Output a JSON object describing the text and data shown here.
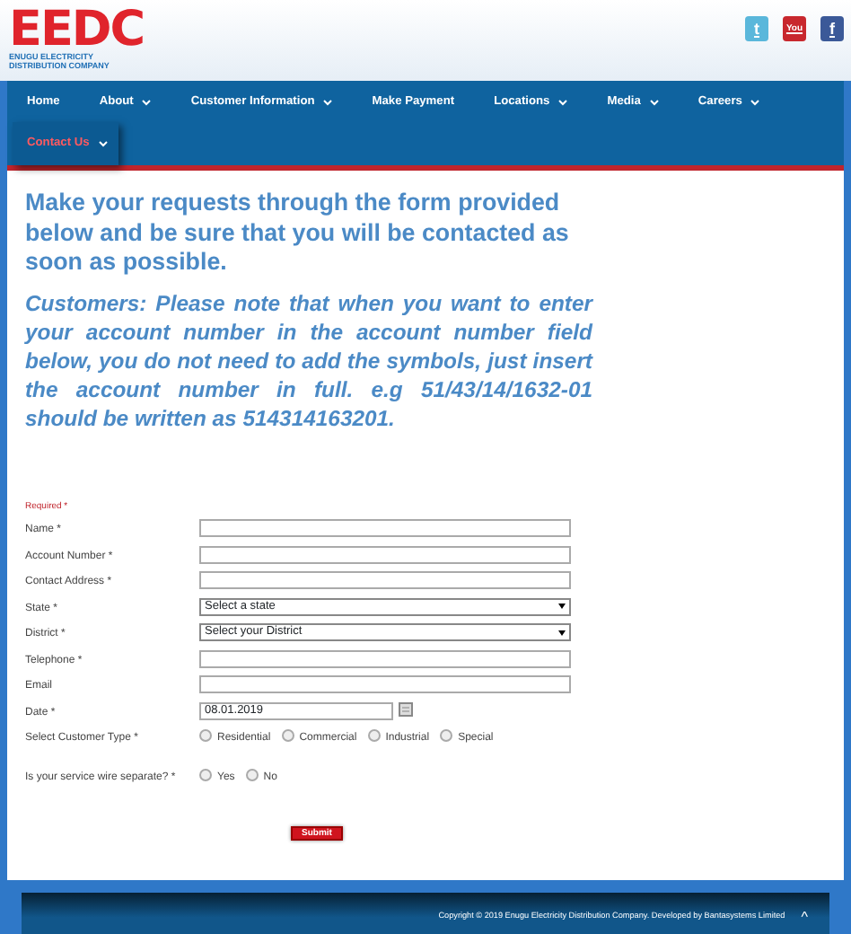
{
  "header": {
    "logo_title": "EEDC",
    "logo_subtitle": "ENUGU ELECTRICITY DISTRIBUTION COMPANY"
  },
  "social_icons": [
    {
      "text": "t",
      "color": "#5ab7db"
    },
    {
      "text": "You",
      "color": "#c8282e"
    },
    {
      "text": "f",
      "color": "#3b5998"
    }
  ],
  "nav": [
    {
      "label": "Home",
      "dropdown": false,
      "selected": false
    },
    {
      "label": "About",
      "dropdown": true,
      "selected": false
    },
    {
      "label": "Customer Information",
      "dropdown": true,
      "selected": false
    },
    {
      "label": "Make Payment",
      "dropdown": false,
      "selected": false
    },
    {
      "label": "Locations",
      "dropdown": true,
      "selected": false
    },
    {
      "label": "Media",
      "dropdown": true,
      "selected": false
    },
    {
      "label": "Careers",
      "dropdown": true,
      "selected": false
    },
    {
      "label": "Contact Us",
      "dropdown": true,
      "selected": true
    }
  ],
  "intro": "Make your requests through the form provided below and be sure that you will be contacted as soon as possible.",
  "notice": "Customers: Please note that when you want to enter your account number in the account number field below, you do not need to add the symbols, just insert the account number in full. e.g 51/43/14/1632-01 should be written as 514314163201.",
  "form": {
    "required_note": "Required *",
    "fields": [
      {
        "kind": "text",
        "label": "Name",
        "mark": "*"
      },
      {
        "kind": "text",
        "label": "Account Number",
        "mark": "*"
      },
      {
        "kind": "text",
        "label": "Contact Address",
        "mark": "*"
      },
      {
        "kind": "select",
        "label": "State",
        "mark": "*",
        "value": "Select a state"
      },
      {
        "kind": "select",
        "label": "District",
        "mark": "*",
        "value": "Select your District"
      },
      {
        "kind": "text",
        "label": "Telephone",
        "mark": "*"
      },
      {
        "kind": "text",
        "label": "Email"
      },
      {
        "kind": "date",
        "label": "Date",
        "mark": "*",
        "value": "08.01.2019"
      },
      {
        "kind": "radio",
        "label": "Select Customer Type",
        "mark": "*",
        "options": [
          {
            "label": "Residential",
            "selected": false
          },
          {
            "label": "Commercial",
            "selected": false
          },
          {
            "label": "Industrial",
            "selected": false
          },
          {
            "label": "Special",
            "selected": false
          }
        ]
      },
      {
        "kind": "radio",
        "label": "Is your service wire separate?",
        "mark": "*",
        "options": [
          {
            "label": "Yes",
            "selected": false
          },
          {
            "label": "No",
            "selected": false
          }
        ]
      }
    ],
    "submit": "Submit"
  },
  "footer": {
    "copyright": "Copyright © 2019 Enugu Electricity Distribution Company. Developed by Bantasystems Limited",
    "top_link": "^"
  }
}
